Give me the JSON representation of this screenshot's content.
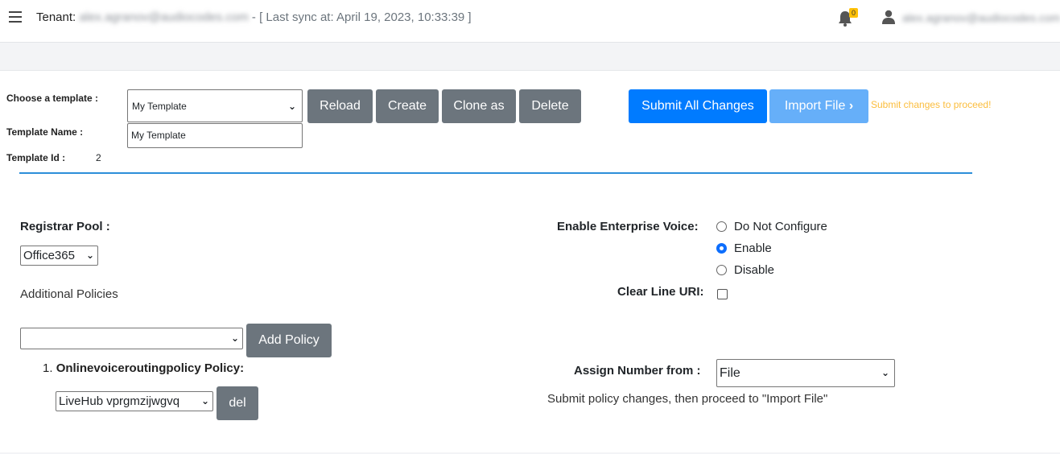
{
  "header": {
    "tenant_label": "Tenant:",
    "tenant_value": "alex.agranov@audiocodes.com",
    "sync_text": "- [ Last sync at: April 19, 2023, 10:33:39 ]",
    "notification_count": "0",
    "user_name": "alex.agranov@audiocodes.com",
    "icons": [
      "hamburger-menu-icon",
      "bell-icon",
      "user-icon"
    ]
  },
  "template": {
    "choose_label": "Choose a template :",
    "selected": "My Template",
    "name_label": "Template Name :",
    "name_value": "My Template",
    "id_label": "Template Id :",
    "id_value": "2"
  },
  "toolbar": {
    "reload": "Reload",
    "create": "Create",
    "clone": "Clone as",
    "delete": "Delete",
    "submit": "Submit All Changes",
    "import": "Import File",
    "warning": "Submit changes to proceed!"
  },
  "form": {
    "registrar_label": "Registrar Pool :",
    "registrar_value": "Office365",
    "additional_policies_label": "Additional Policies",
    "policy_select_value": "",
    "add_policy": "Add Policy",
    "policy_item_number": "1.",
    "policy_item_title": "Onlinevoiceroutingpolicy Policy:",
    "policy_item_value": "LiveHub vprgmzijwgvq",
    "del": "del",
    "enterprise_voice_label": "Enable Enterprise Voice:",
    "enterprise_voice_options": [
      "Do Not Configure",
      "Enable",
      "Disable"
    ],
    "enterprise_voice_selected": "Enable",
    "clear_line_uri_label": "Clear Line URI:",
    "clear_line_uri_checked": false,
    "assign_number_label": "Assign Number from :",
    "assign_number_value": "File",
    "hint": "Submit policy changes, then proceed to \"Import File\""
  },
  "colors": {
    "primary": "#007bff",
    "secondary": "#6c757d",
    "disabled_primary": "#66aff9",
    "warning": "#fbbd3d",
    "divider": "#2c8fd9"
  }
}
